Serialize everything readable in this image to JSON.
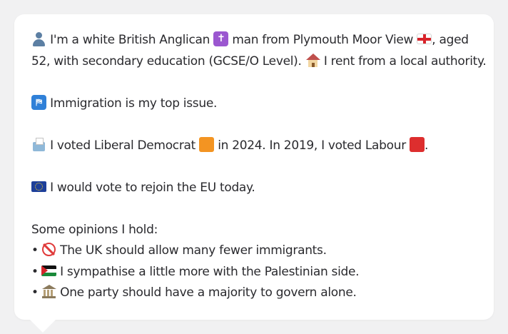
{
  "profile": {
    "line1_a": "I'm a white British Anglican",
    "line1_b": "man from Plymouth Moor View",
    "line1_c": ", aged 52, with secondary education (GCSE/O Level).",
    "line1_d": "I rent from a local authority.",
    "issue": "Immigration is my top issue.",
    "vote_a": "I voted Liberal Democrat",
    "vote_b": "in 2024. In 2019, I voted Labour",
    "vote_c": ".",
    "eu": "I would vote to rejoin the EU today.",
    "opinions_heading": "Some opinions I hold:",
    "bullet_char": "•",
    "opinions": [
      "The UK should allow many fewer immigrants.",
      "I sympathise a little more with the Palestinian side.",
      "One party should have a majority to govern alone."
    ]
  },
  "icons": {
    "person": "bust-silhouette-icon",
    "religion": "latin-cross-icon",
    "region": "england-flag-icon",
    "housing": "house-icon",
    "issue": "immigration-icon",
    "ballot": "ballot-box-icon",
    "libdem": "orange-square-icon",
    "labour": "red-square-icon",
    "eu": "eu-flag-icon",
    "opinion_1": "prohibited-icon",
    "opinion_2": "palestine-flag-icon",
    "opinion_3": "classical-building-icon"
  },
  "colors": {
    "libdem_orange": "#f39422",
    "labour_red": "#dd2e2e",
    "text": "#2a2a2e",
    "bubble": "#ffffff",
    "background": "#f1f1f2"
  }
}
